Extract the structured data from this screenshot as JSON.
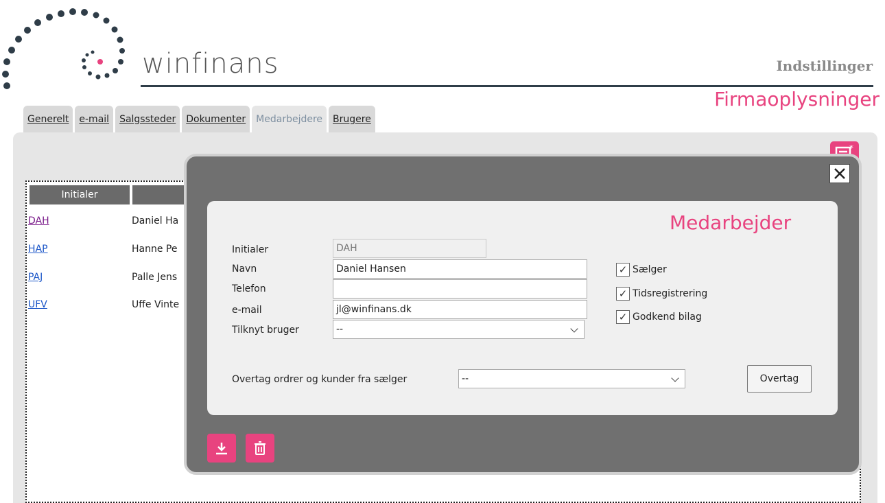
{
  "header": {
    "brand": "winfinans",
    "section": "Indstillinger",
    "page_title": "Firmaoplysninger"
  },
  "tabs": [
    {
      "label": "Generelt",
      "active": false
    },
    {
      "label": "e-mail",
      "active": false
    },
    {
      "label": "Salgssteder",
      "active": false
    },
    {
      "label": "Dokumenter",
      "active": false
    },
    {
      "label": "Medarbejdere",
      "active": true
    },
    {
      "label": "Brugere",
      "active": false
    }
  ],
  "table": {
    "columns": [
      "Initialer",
      ""
    ],
    "rows": [
      {
        "initials": "DAH",
        "name": "Daniel Ha"
      },
      {
        "initials": "HAP",
        "name": "Hanne Pe"
      },
      {
        "initials": "PAJ",
        "name": "Palle Jens"
      },
      {
        "initials": "UFV",
        "name": "Uffe Vinte"
      }
    ]
  },
  "modal": {
    "title": "Medarbejder",
    "fields": {
      "initials_label": "Initialer",
      "initials_value": "DAH",
      "name_label": "Navn",
      "name_value": "Daniel Hansen",
      "phone_label": "Telefon",
      "phone_value": "",
      "email_label": "e-mail",
      "email_value": "jl@winfinans.dk",
      "user_label": "Tilknyt bruger",
      "user_value": "--"
    },
    "checkboxes": [
      {
        "label": "Sælger",
        "checked": true
      },
      {
        "label": "Tidsregistrering",
        "checked": true
      },
      {
        "label": "Godkend bilag",
        "checked": true
      }
    ],
    "takeover_label": "Overtag ordrer og kunder fra sælger",
    "takeover_value": "--",
    "takeover_button": "Overtag"
  },
  "colors": {
    "accent": "#e8437f",
    "modal_bg": "#707070",
    "header_rule": "#2f3d48"
  },
  "icons": [
    "new-record-icon",
    "close-icon",
    "save-download-icon",
    "trash-icon",
    "chevron-down-icon",
    "checkmark-icon"
  ]
}
